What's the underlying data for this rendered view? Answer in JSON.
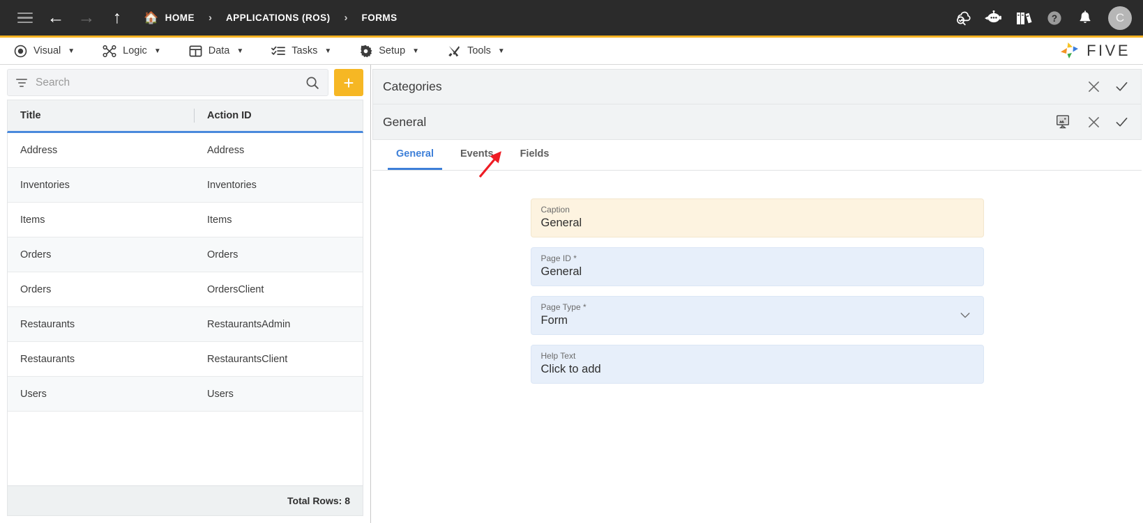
{
  "topbar": {
    "menu_icon": "hamburger-icon",
    "back_icon": "arrow-left-icon",
    "forward_icon": "arrow-right-icon",
    "up_icon": "arrow-up-icon",
    "breadcrumbs": [
      {
        "label": "HOME",
        "icon": "home-icon"
      },
      {
        "label": "APPLICATIONS (ROS)",
        "icon": ""
      },
      {
        "label": "FORMS",
        "icon": ""
      }
    ],
    "separator": "›",
    "right_icons": [
      "cloud-check-icon",
      "chatbot-icon",
      "books-icon",
      "help-icon",
      "bell-icon"
    ],
    "avatar_initial": "C",
    "accent_color": "#f5b323",
    "background_color": "#2b2b2b"
  },
  "menubar": {
    "items": [
      {
        "label": "Visual",
        "icon": "eye-icon"
      },
      {
        "label": "Logic",
        "icon": "logic-nodes-icon"
      },
      {
        "label": "Data",
        "icon": "table-grid-icon"
      },
      {
        "label": "Tasks",
        "icon": "task-list-icon"
      },
      {
        "label": "Setup",
        "icon": "gear-icon"
      },
      {
        "label": "Tools",
        "icon": "tools-icon"
      }
    ],
    "caret": "▼",
    "brand": "FIVE"
  },
  "left_panel": {
    "search": {
      "placeholder": "Search",
      "value": "",
      "filter_icon": "filter-icon",
      "search_icon": "search-icon"
    },
    "add_button_label": "+",
    "add_button_color": "#f6b724",
    "columns": [
      "Title",
      "Action ID"
    ],
    "rows": [
      {
        "title": "Address",
        "action_id": "Address"
      },
      {
        "title": "Inventories",
        "action_id": "Inventories"
      },
      {
        "title": "Items",
        "action_id": "Items"
      },
      {
        "title": "Orders",
        "action_id": "Orders"
      },
      {
        "title": "Orders",
        "action_id": "OrdersClient"
      },
      {
        "title": "Restaurants",
        "action_id": "RestaurantsAdmin"
      },
      {
        "title": "Restaurants",
        "action_id": "RestaurantsClient"
      },
      {
        "title": "Users",
        "action_id": "Users"
      }
    ],
    "footer_text": "Total Rows: 8",
    "header_underline_color": "#4a89dc"
  },
  "right_panel": {
    "outer_title": "Categories",
    "outer_close_icon": "close-icon",
    "outer_confirm_icon": "check-icon",
    "inner_title": "General",
    "inner_monitor_icon": "monitor-preview-icon",
    "inner_close_icon": "close-icon",
    "inner_confirm_icon": "check-icon",
    "tabs": [
      {
        "label": "General",
        "active": true
      },
      {
        "label": "Events",
        "active": false
      },
      {
        "label": "Fields",
        "active": false
      }
    ],
    "active_tab_color": "#3d7fd8",
    "fields": [
      {
        "label": "Caption",
        "required": "",
        "value": "General",
        "style": "caption",
        "dropdown": false
      },
      {
        "label": "Page ID",
        "required": "*",
        "value": "General",
        "style": "blue",
        "dropdown": false
      },
      {
        "label": "Page Type",
        "required": "*",
        "value": "Form",
        "style": "blue",
        "dropdown": true
      },
      {
        "label": "Help Text",
        "required": "",
        "value": "Click to add",
        "style": "blue",
        "dropdown": false
      }
    ],
    "annotation": {
      "type": "red-arrow",
      "points_to": "Fields",
      "color": "#ee1c24"
    }
  }
}
